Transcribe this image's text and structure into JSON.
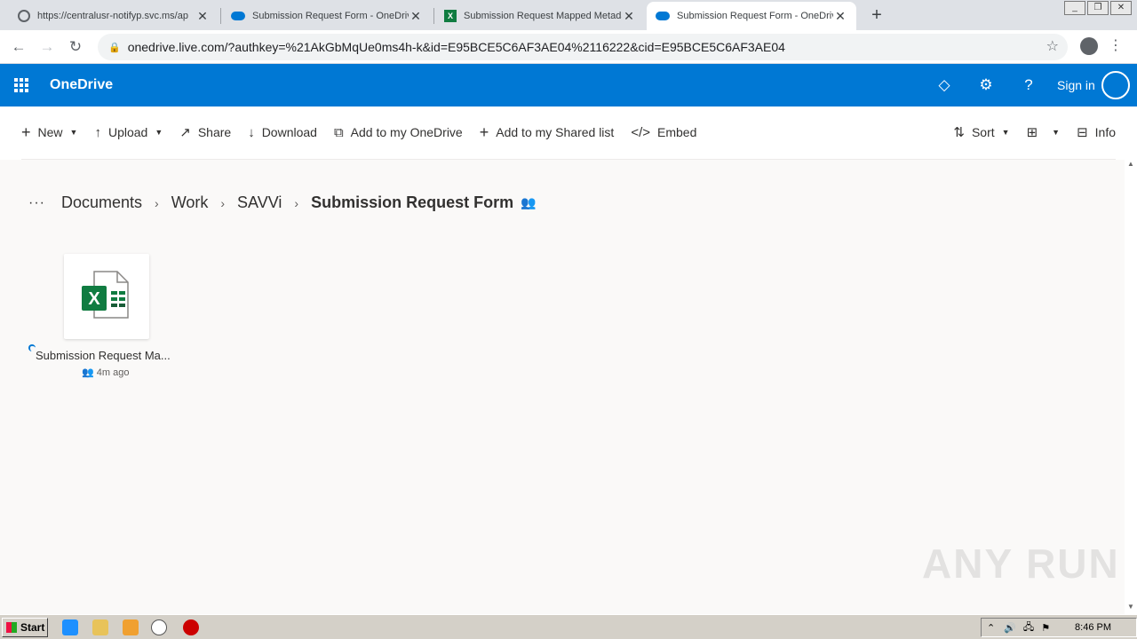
{
  "browser": {
    "tabs": [
      {
        "title": "https://centralusr-notifyp.svc.ms/ap",
        "favicon": "globe-icon"
      },
      {
        "title": "Submission Request Form - OneDrive",
        "favicon": "onedrive-cloud-icon"
      },
      {
        "title": "Submission Request Mapped Metada",
        "favicon": "excel-icon"
      },
      {
        "title": "Submission Request Form - OneDrive",
        "favicon": "onedrive-cloud-icon"
      }
    ],
    "url": "onedrive.live.com/?authkey=%21AkGbMqUe0ms4h-k&id=E95BCE5C6AF3AE04%2116222&cid=E95BCE5C6AF3AE04"
  },
  "header": {
    "brand": "OneDrive",
    "sign_in": "Sign in",
    "accent": "#0078d4"
  },
  "commands": {
    "new": "New",
    "upload": "Upload",
    "share": "Share",
    "download": "Download",
    "add_to_onedrive": "Add to my OneDrive",
    "add_to_shared": "Add to my Shared list",
    "embed": "Embed",
    "sort": "Sort",
    "info": "Info"
  },
  "breadcrumb": {
    "items": [
      "Documents",
      "Work",
      "SAVVi"
    ],
    "current": "Submission Request Form"
  },
  "files": [
    {
      "name": "Submission Request Ma...",
      "modified": "4m ago",
      "type": "excel"
    }
  ],
  "watermark": "ANY RUN",
  "taskbar": {
    "start": "Start",
    "time": "8:46 PM"
  }
}
